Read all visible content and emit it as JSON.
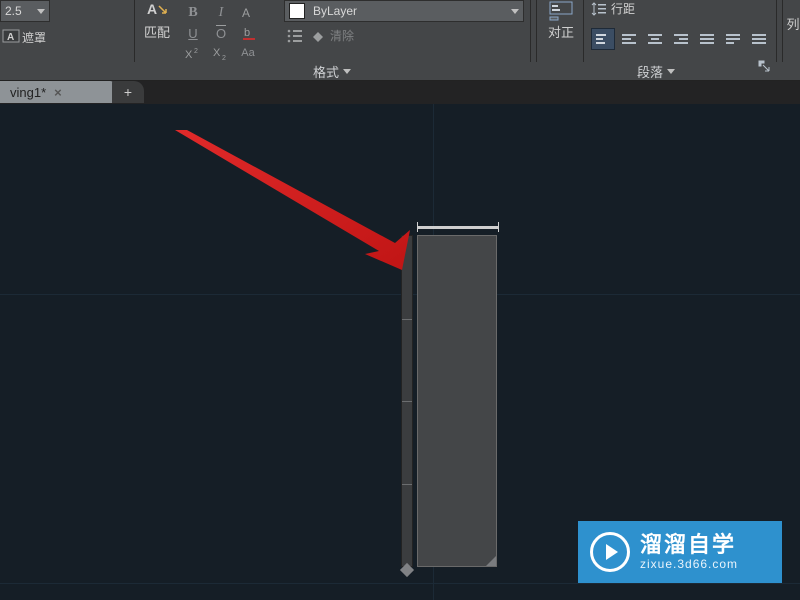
{
  "ribbon": {
    "text_height": "2.5",
    "match_label": "匹配",
    "mask_label": "遮罩",
    "clear_label": "清除",
    "format_panel": "格式",
    "bylayer": "ByLayer",
    "justify_label": "对正",
    "linespacing_label": "行距",
    "paragraph_panel": "段落",
    "right_cut_label": "列"
  },
  "tabs": {
    "active": "ving1*"
  },
  "watermark": {
    "line1": "溜溜自学",
    "line2": "zixue.3d66.com"
  }
}
